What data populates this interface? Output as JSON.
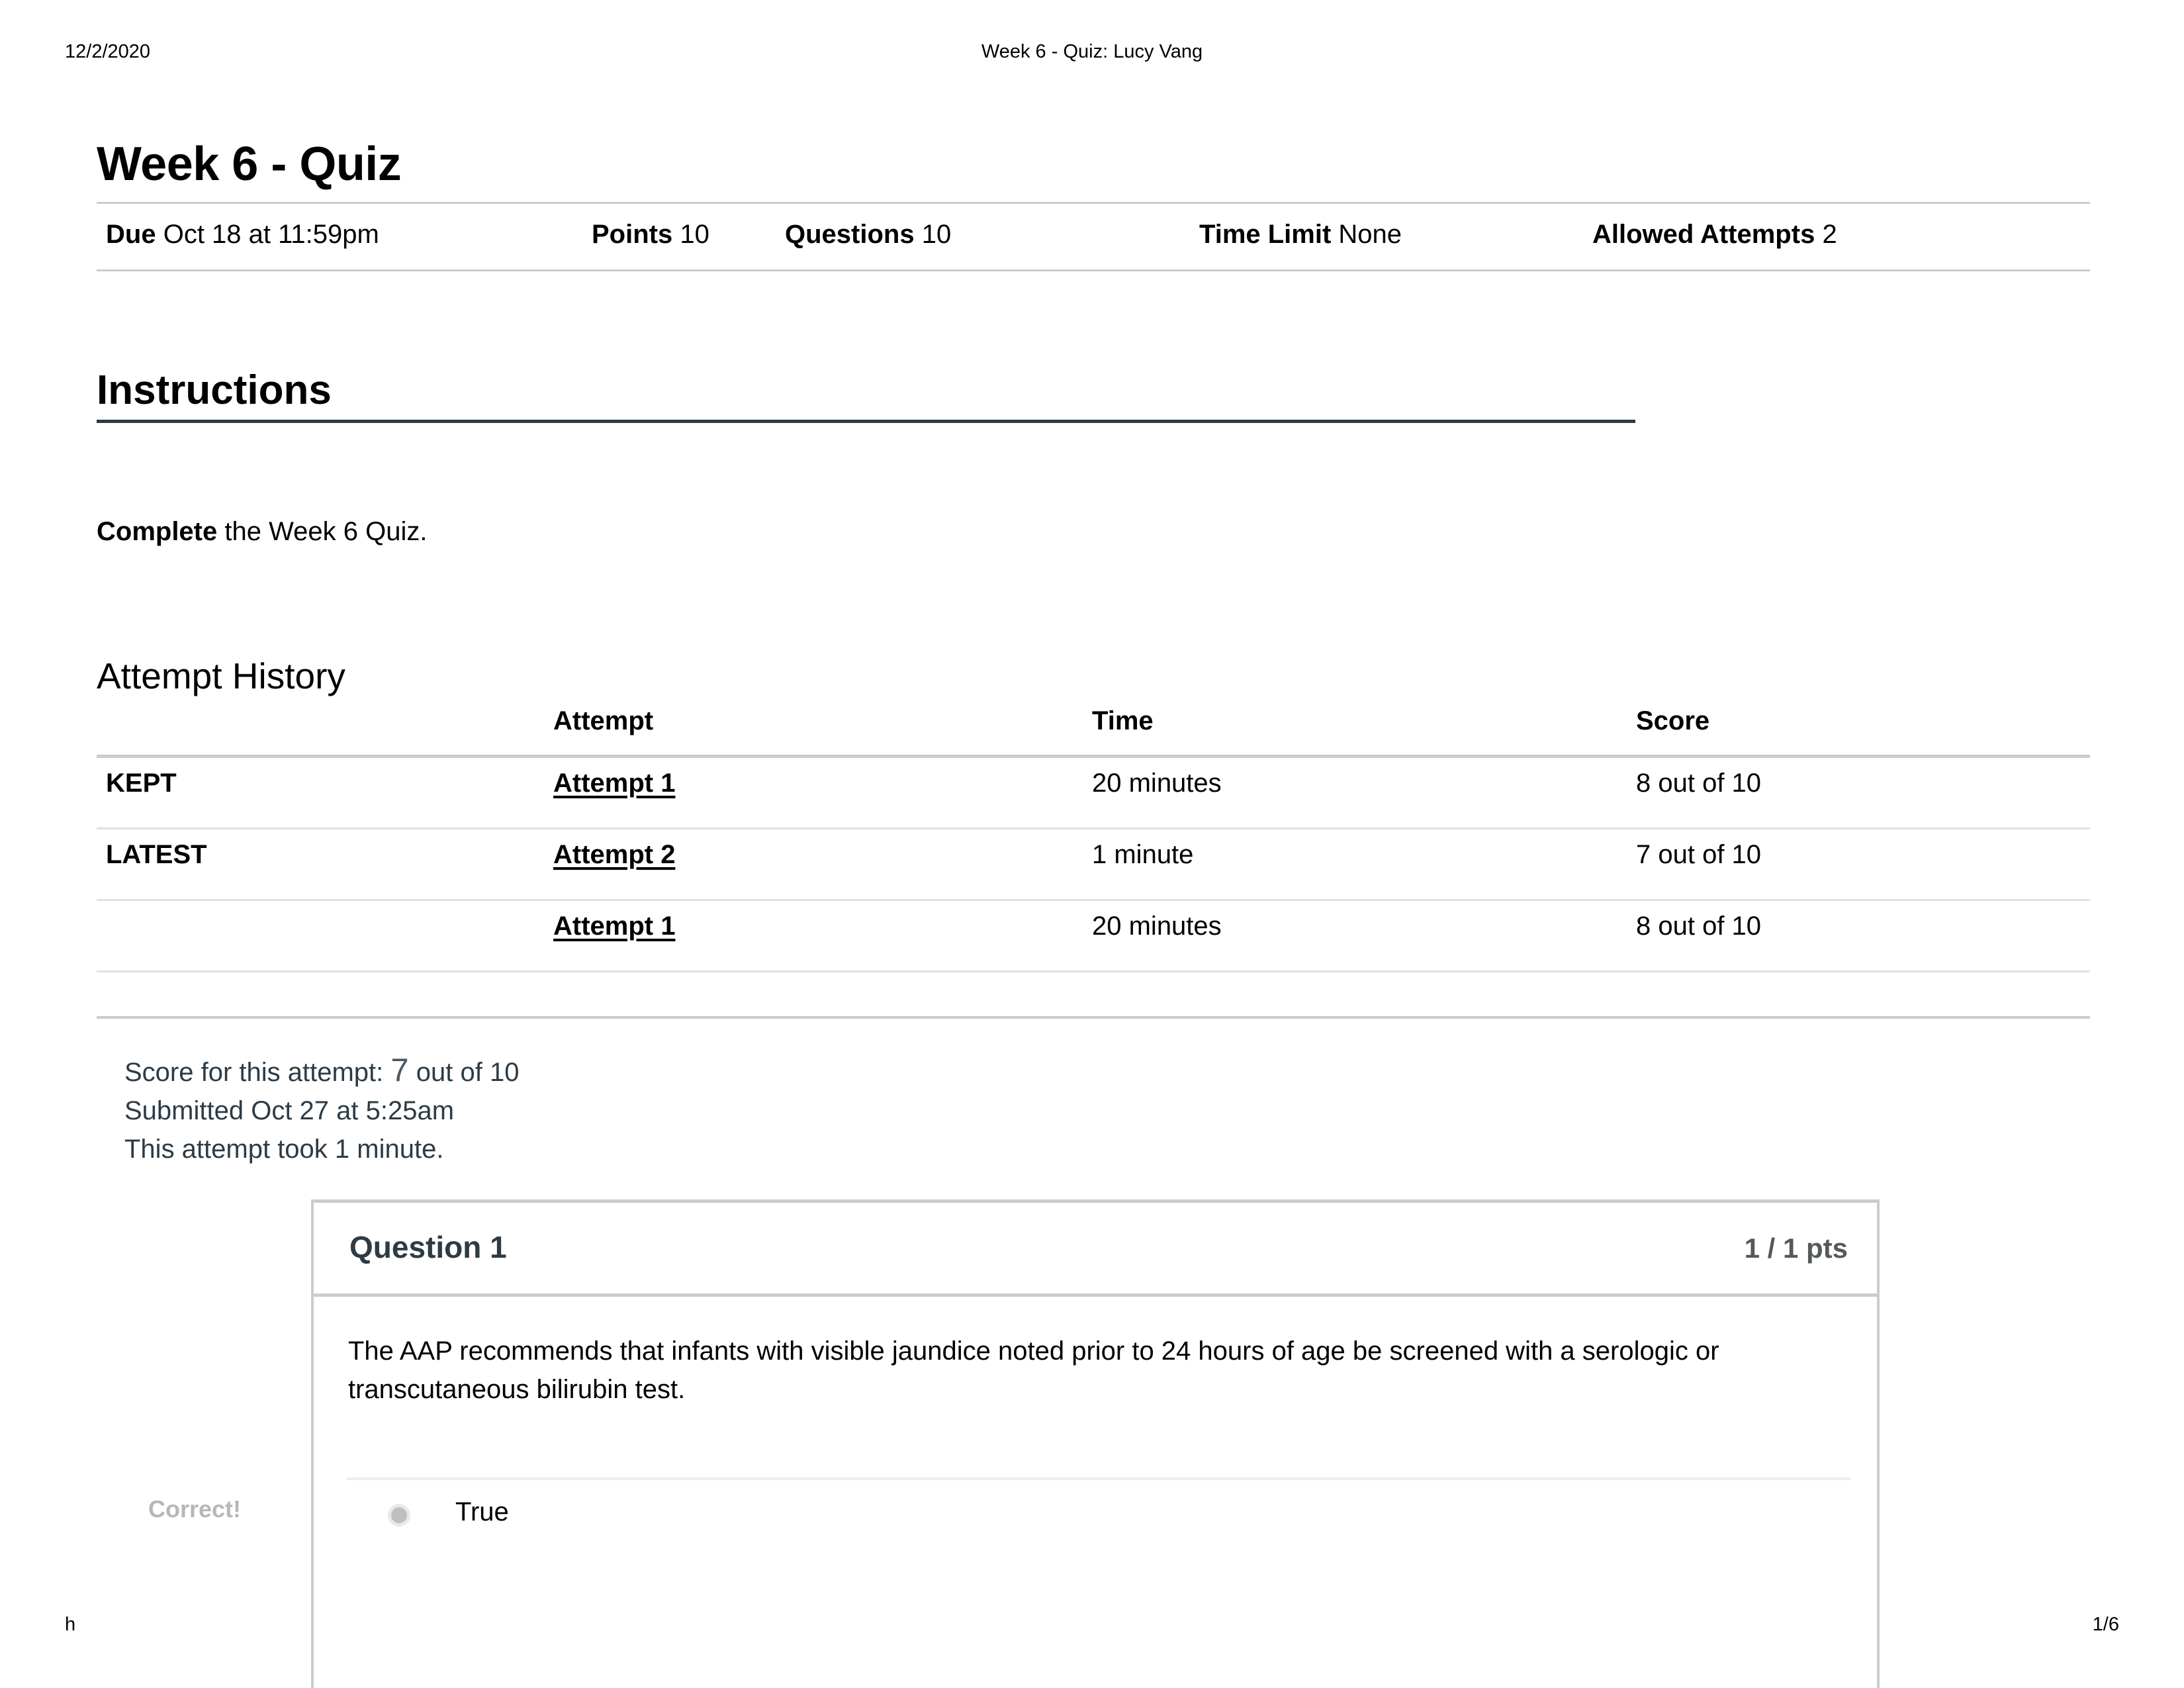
{
  "print": {
    "date": "12/2/2020",
    "doc_title": "Week 6 - Quiz: Lucy Vang",
    "footer_url": "h",
    "page_number": "1/6"
  },
  "quiz": {
    "title": "Week 6 - Quiz",
    "meta": [
      {
        "label": "Due",
        "value": "Oct 18 at 11:59pm"
      },
      {
        "label": "Points",
        "value": "10"
      },
      {
        "label": "Questions",
        "value": "10"
      },
      {
        "label": "Time Limit",
        "value": "None"
      },
      {
        "label": "Allowed Attempts",
        "value": "2"
      }
    ]
  },
  "instructions": {
    "heading": "Instructions",
    "body_bold": "Complete",
    "body_rest": " the Week 6 Quiz."
  },
  "attempt_history": {
    "heading": "Attempt History",
    "columns": {
      "label": "",
      "attempt": "Attempt",
      "time": "Time",
      "score": "Score"
    },
    "rows": [
      {
        "label": "KEPT",
        "attempt": "Attempt 1",
        "time": "20 minutes",
        "score": "8 out of 10"
      },
      {
        "label": "LATEST",
        "attempt": "Attempt 2",
        "time": "1 minute",
        "score": "7 out of 10"
      },
      {
        "label": "",
        "attempt": "Attempt 1",
        "time": "20 minutes",
        "score": "8 out of 10"
      }
    ]
  },
  "attempt_summary": {
    "score_prefix": "Score for this attempt: ",
    "score_value": "7",
    "score_suffix": " out of 10",
    "submitted": "Submitted Oct 27 at 5:25am",
    "duration": "This attempt took 1 minute."
  },
  "question": {
    "title": "Question 1",
    "points": "1 / 1 pts",
    "text": "The AAP recommends that infants with visible jaundice noted prior to 24 hours of age be screened with a serologic or transcutaneous bilirubin test.",
    "feedback": "Correct!",
    "selected_answer": "True"
  },
  "colors": {
    "text": "#000000",
    "muted": "#2d3b45",
    "rule": "#c7cdd1",
    "light_rule": "#dde2e5",
    "feedback_gray": "#b5b8ba",
    "points_gray": "#55595c"
  }
}
